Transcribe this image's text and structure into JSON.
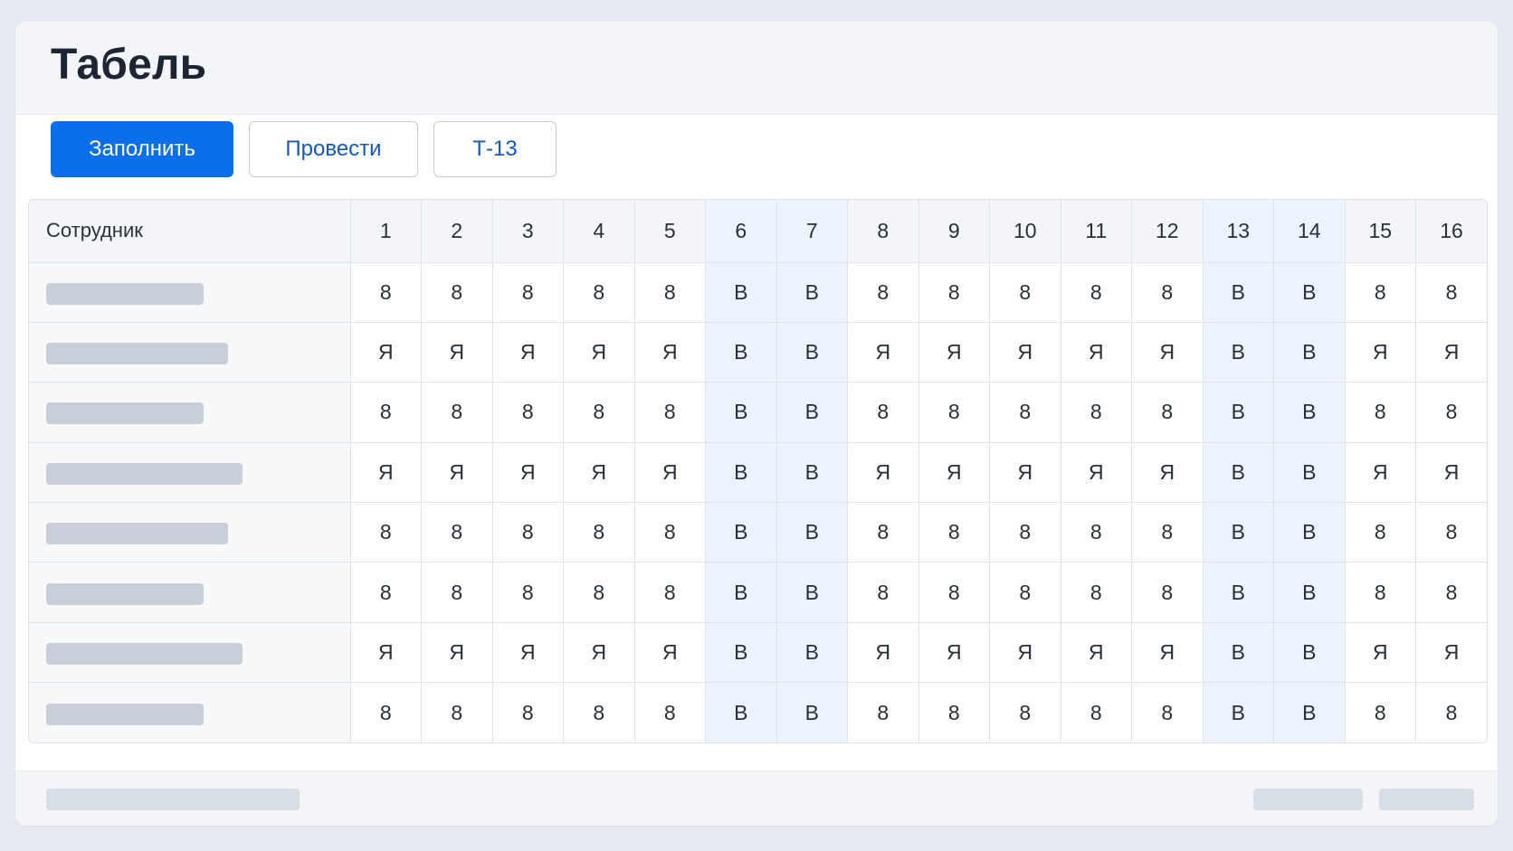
{
  "header": {
    "title": "Табель"
  },
  "toolbar": {
    "fill_label": "Заполнить",
    "post_label": "Провести",
    "t13_label": "Т-13"
  },
  "table": {
    "employee_header": "Сотрудник",
    "days": [
      "1",
      "2",
      "3",
      "4",
      "5",
      "6",
      "7",
      "8",
      "9",
      "10",
      "11",
      "12",
      "13",
      "14",
      "15",
      "16"
    ],
    "weekend_days": [
      6,
      7,
      13,
      14
    ],
    "rows": [
      {
        "values": [
          "8",
          "8",
          "8",
          "8",
          "8",
          "В",
          "В",
          "8",
          "8",
          "8",
          "8",
          "8",
          "В",
          "В",
          "8",
          "8"
        ]
      },
      {
        "values": [
          "Я",
          "Я",
          "Я",
          "Я",
          "Я",
          "В",
          "В",
          "Я",
          "Я",
          "Я",
          "Я",
          "Я",
          "В",
          "В",
          "Я",
          "Я"
        ]
      },
      {
        "values": [
          "8",
          "8",
          "8",
          "8",
          "8",
          "В",
          "В",
          "8",
          "8",
          "8",
          "8",
          "8",
          "В",
          "В",
          "8",
          "8"
        ]
      },
      {
        "values": [
          "Я",
          "Я",
          "Я",
          "Я",
          "Я",
          "В",
          "В",
          "Я",
          "Я",
          "Я",
          "Я",
          "Я",
          "В",
          "В",
          "Я",
          "Я"
        ]
      },
      {
        "values": [
          "8",
          "8",
          "8",
          "8",
          "8",
          "В",
          "В",
          "8",
          "8",
          "8",
          "8",
          "8",
          "В",
          "В",
          "8",
          "8"
        ]
      },
      {
        "values": [
          "8",
          "8",
          "8",
          "8",
          "8",
          "В",
          "В",
          "8",
          "8",
          "8",
          "8",
          "8",
          "В",
          "В",
          "8",
          "8"
        ]
      },
      {
        "values": [
          "Я",
          "Я",
          "Я",
          "Я",
          "Я",
          "В",
          "В",
          "Я",
          "Я",
          "Я",
          "Я",
          "Я",
          "В",
          "В",
          "Я",
          "Я"
        ]
      },
      {
        "values": [
          "8",
          "8",
          "8",
          "8",
          "8",
          "В",
          "В",
          "8",
          "8",
          "8",
          "8",
          "8",
          "В",
          "В",
          "8",
          "8"
        ]
      }
    ]
  },
  "colors": {
    "accent": "#0a6fe8",
    "weekend_bg": "#edf4fd",
    "placeholder": "#c8cfd9"
  }
}
